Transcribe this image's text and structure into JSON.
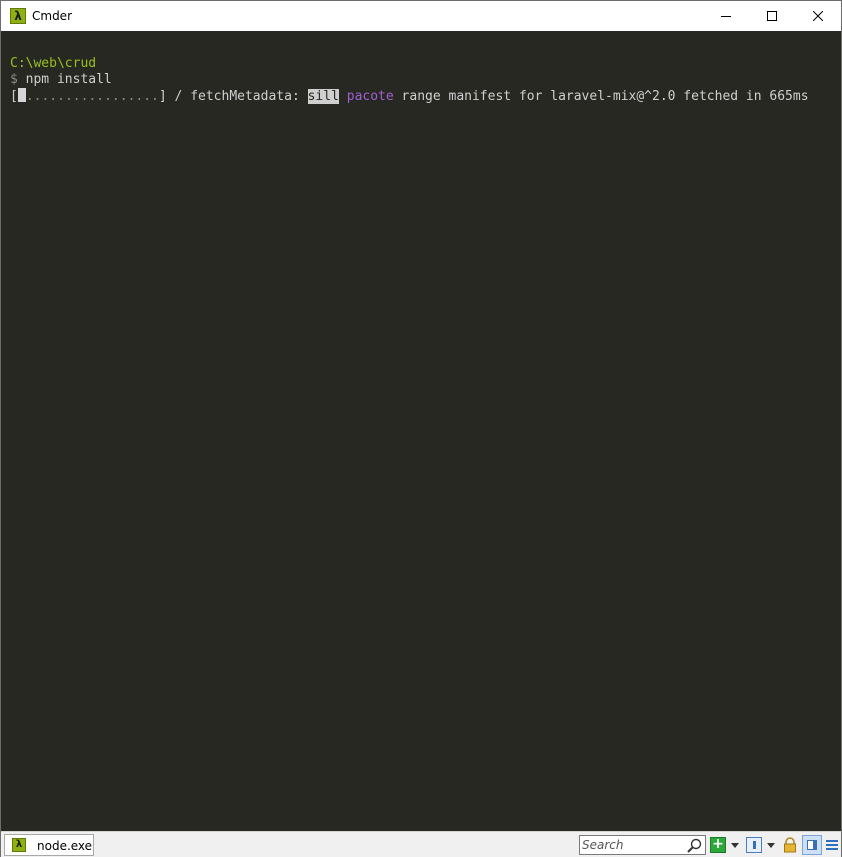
{
  "window": {
    "title": "Cmder",
    "app_icon_glyph": "λ"
  },
  "terminal": {
    "prompt_path": "C:\\web\\crud",
    "prompt_symbol": "$",
    "command": "npm install",
    "progress_open": "[",
    "progress_dots": ".................",
    "progress_close": "]",
    "progress_rest": " / fetchMetadata: ",
    "log_level": "sill",
    "log_source": "pacote",
    "log_message": " range manifest for laravel-mix@^2.0 fetched in 665ms",
    "colors": {
      "background": "#272822",
      "prompt": "#98c21a",
      "text": "#cfcfcf",
      "source": "#a15fd6"
    }
  },
  "statusbar": {
    "task_icon_glyph": "λ",
    "task_label": "node.exe",
    "search_placeholder": "Search",
    "add_glyph": "+",
    "icons": [
      "search-icon",
      "add-console-icon",
      "dropdown-icon",
      "console-icon",
      "lock-icon",
      "split-view-icon",
      "menu-icon"
    ]
  }
}
